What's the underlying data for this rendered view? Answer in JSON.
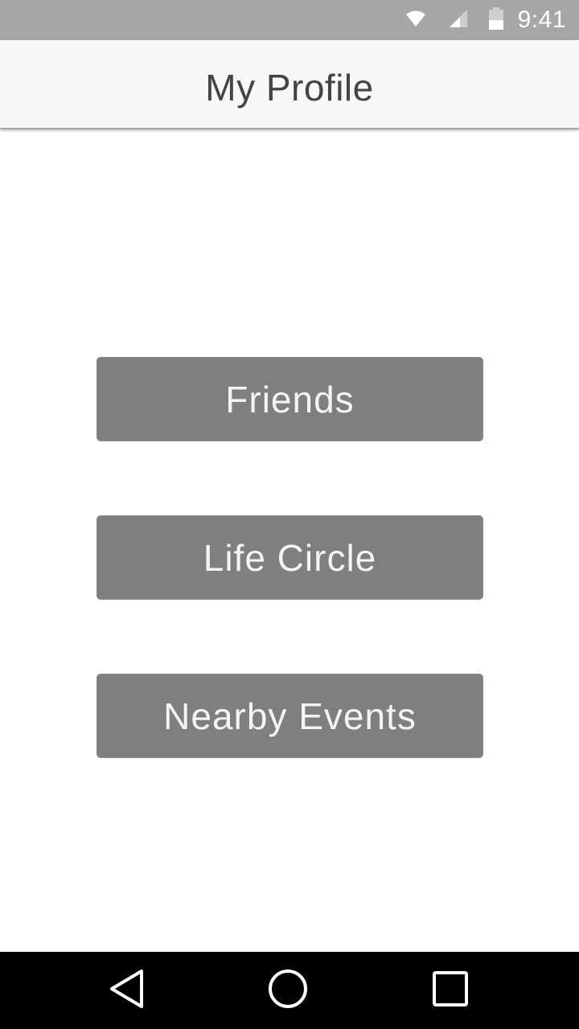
{
  "status_bar": {
    "time": "9:41",
    "icons": [
      "wifi-icon",
      "cell-signal-icon",
      "battery-icon"
    ],
    "background": "#a6a6a6"
  },
  "app_bar": {
    "title": "My Profile"
  },
  "main": {
    "buttons": [
      {
        "label": "Friends"
      },
      {
        "label": "Life Circle"
      },
      {
        "label": "Nearby Events"
      }
    ],
    "button_color": "#7f7f7f",
    "button_text_color": "#f4f4f4"
  },
  "nav_bar": {
    "icons": [
      "back-icon",
      "home-icon",
      "recents-icon"
    ]
  }
}
